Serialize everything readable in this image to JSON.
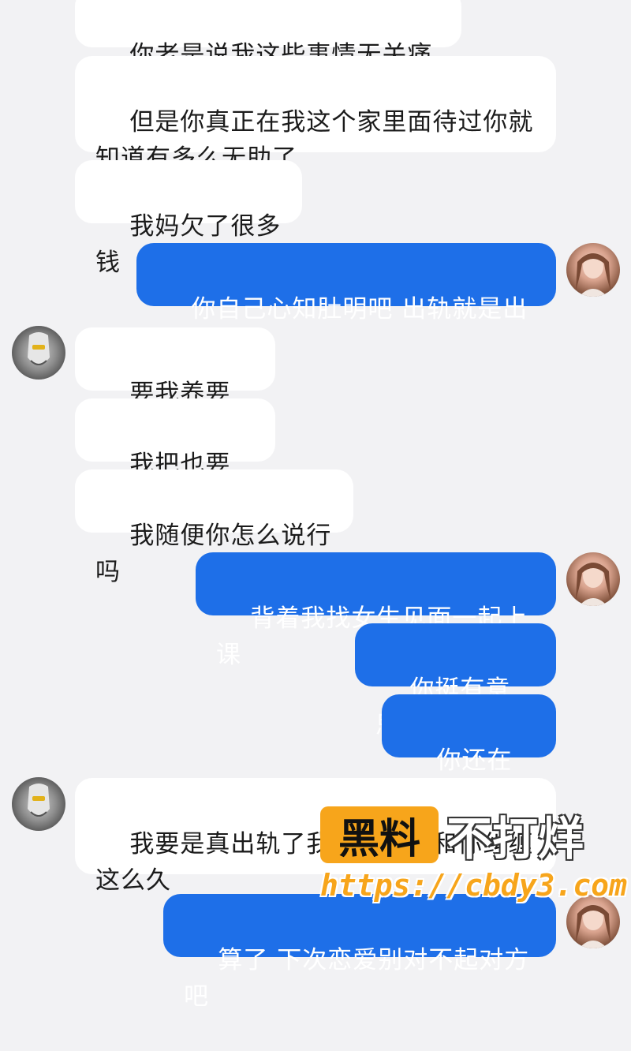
{
  "messages": [
    {
      "side": "in",
      "text": "你老是说我这些事情无关痛痒"
    },
    {
      "side": "in",
      "text": "但是你真正在我这个家里面待过你就\n知道有多么无助了"
    },
    {
      "side": "in",
      "text": "我妈欠了很多钱"
    },
    {
      "side": "out",
      "text": "你自己心知肚明吧 出轨就是出轨"
    },
    {
      "side": "in",
      "text": "要我养要我还"
    },
    {
      "side": "in",
      "text": "我把也要我养"
    },
    {
      "side": "in",
      "text": "我随便你怎么说行吗"
    },
    {
      "side": "out",
      "text": "背着我找女生见面一起上课"
    },
    {
      "side": "out",
      "text": "你挺有意思的"
    },
    {
      "side": "out",
      "text": "你还在逃避"
    },
    {
      "side": "in",
      "text": "我要是真出轨了我就不可能和你纠缠\n这么久"
    },
    {
      "side": "out",
      "text": "算了 下次恋爱别对不起对方吧"
    }
  ],
  "avatars": {
    "me": "avatar-self-photo",
    "other": "avatar-other-mask-icon"
  },
  "watermark": {
    "brand_highlight": "黑料",
    "brand_rest": "不打烊",
    "url": "https://cbdy3.com"
  },
  "colors": {
    "background": "#f2f2f4",
    "incoming_bubble": "#ffffff",
    "outgoing_bubble": "#1e6fe8",
    "watermark_orange": "#f7a51b"
  }
}
